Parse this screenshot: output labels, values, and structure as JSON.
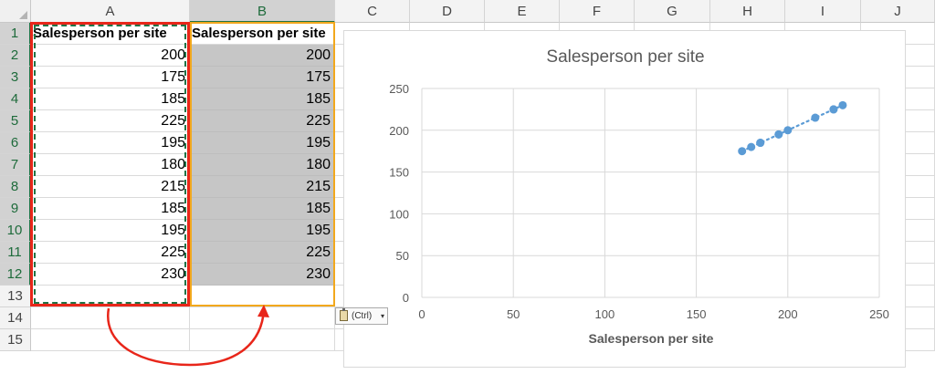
{
  "sheet": {
    "columns": [
      "A",
      "B",
      "C",
      "D",
      "E",
      "F",
      "G",
      "H",
      "I",
      "J"
    ],
    "rows": [
      "1",
      "2",
      "3",
      "4",
      "5",
      "6",
      "7",
      "8",
      "9",
      "10",
      "11",
      "12",
      "13",
      "14",
      "15"
    ],
    "header_label": "Salesperson per site",
    "values": [
      "200",
      "175",
      "185",
      "225",
      "195",
      "180",
      "215",
      "185",
      "195",
      "225",
      "230"
    ]
  },
  "paste_options": {
    "label": "(Ctrl)",
    "arrow": "▾"
  },
  "chart_data": {
    "type": "scatter",
    "title": "Salesperson per site",
    "xlabel": "Salesperson per site",
    "ylabel": "",
    "xlim": [
      0,
      250
    ],
    "ylim": [
      0,
      250
    ],
    "xticks": [
      "0",
      "50",
      "100",
      "150",
      "200",
      "250"
    ],
    "yticks": [
      "0",
      "50",
      "100",
      "150",
      "200",
      "250"
    ],
    "x": [
      200,
      175,
      185,
      225,
      195,
      180,
      215,
      185,
      195,
      225,
      230
    ],
    "y": [
      200,
      175,
      185,
      225,
      195,
      180,
      215,
      185,
      195,
      225,
      230
    ],
    "trendline": "linear dotted",
    "grid": true,
    "marker_color": "#5b9bd5"
  },
  "colors": {
    "red_box": "#e8261a",
    "copy_border": "#217346",
    "paste_border": "#f2a81d",
    "arrow": "#e8261a",
    "selection_fill": "#c6c6c6"
  }
}
